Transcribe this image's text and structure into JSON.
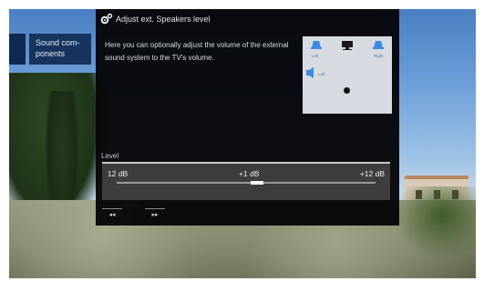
{
  "side_menu": {
    "item_label": "Sound com-\nponents"
  },
  "panel": {
    "title": "Adjust ext. Speakers level",
    "description": "Here you can optionally adjust the volume of the external sound system to the TV's volume."
  },
  "diagram": {
    "speaker_labels": [
      "Left",
      "Right",
      "Left"
    ],
    "colors": {
      "speaker": "#3a8be0",
      "tv": "#1a1a1a",
      "listener": "#111111"
    }
  },
  "level": {
    "label": "Level",
    "min_label": "12 dB",
    "current_label": "+1 dB",
    "max_label": "+12 dB",
    "current_value_db": 1,
    "min_db": -12,
    "max_db": 12
  },
  "nav": {
    "prev_icon": "rewind-icon",
    "next_icon": "fast-forward-icon",
    "prev_glyph": "◂◂",
    "next_glyph": "▸▸"
  }
}
